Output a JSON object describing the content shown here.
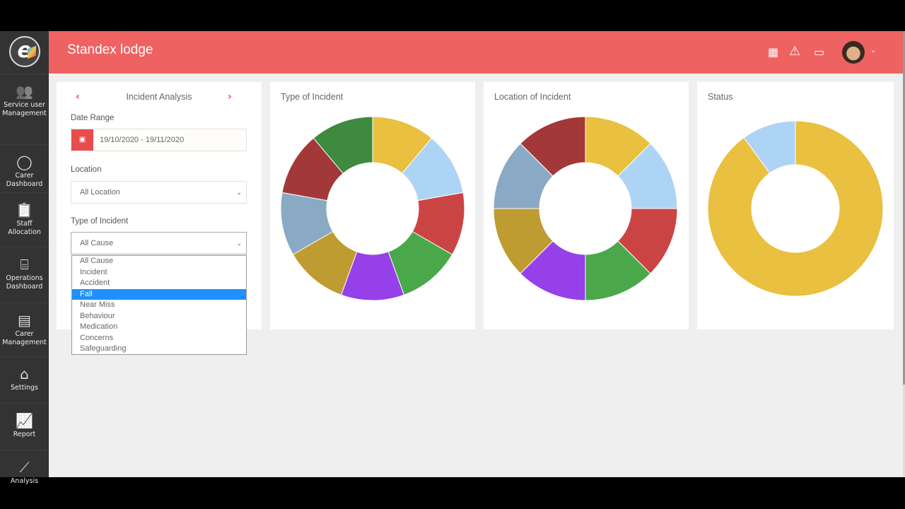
{
  "header": {
    "title": "Standex lodge",
    "icons": [
      "calendar-icon",
      "warning-icon",
      "message-icon"
    ]
  },
  "sidebar": {
    "items": [
      {
        "label1": "Service user",
        "label2": "Management",
        "icon": "users-icon"
      },
      {
        "label1": "Carer",
        "label2": "Dashboard",
        "icon": "user-circle-icon"
      },
      {
        "label1": "Staff",
        "label2": "Allocation",
        "icon": "clipboard-icon"
      },
      {
        "label1": "Operations",
        "label2": "Dashboard",
        "icon": "sitemap-icon"
      },
      {
        "label1": "Carer",
        "label2": "Management",
        "icon": "id-card-icon"
      },
      {
        "label1": "Settings",
        "label2": "",
        "icon": "home-icon"
      },
      {
        "label1": "Report",
        "label2": "",
        "icon": "chart-icon"
      },
      {
        "label1": "Analysis",
        "label2": "",
        "icon": "line-chart-icon"
      }
    ]
  },
  "filter": {
    "title": "Incident Analysis",
    "date_label": "Date Range",
    "date_value": "19/10/2020 - 19/11/2020",
    "location_label": "Location",
    "location_value": "All Location",
    "type_label": "Type of Incident",
    "type_value": "All Cause",
    "options": [
      "All Cause",
      "Incident",
      "Accident",
      "Fall",
      "Near Miss",
      "Behaviour",
      "Medication",
      "Concerns",
      "Safeguarding"
    ],
    "highlighted": "Fall"
  },
  "colors": {
    "header": "#ef6262",
    "highlight": "#1e90ff"
  },
  "chart_data": [
    {
      "type": "pie",
      "title": "Type of Incident",
      "donut": true,
      "values": [
        1,
        1,
        1,
        1,
        1,
        1,
        1,
        1,
        1
      ],
      "colors": [
        "#e9c03f",
        "#aed4f5",
        "#cb4444",
        "#4aa84a",
        "#9540e8",
        "#bf9c32",
        "#8aa9c5",
        "#a33838",
        "#3e8a3e"
      ]
    },
    {
      "type": "pie",
      "title": "Location of Incident",
      "donut": true,
      "values": [
        1,
        1,
        1,
        1,
        1,
        1,
        1,
        1
      ],
      "colors": [
        "#e9c03f",
        "#aed4f5",
        "#cb4444",
        "#4aa84a",
        "#9540e8",
        "#bf9c32",
        "#8aa9c5",
        "#a33838"
      ]
    },
    {
      "type": "pie",
      "title": "Status",
      "donut": true,
      "values": [
        9,
        1
      ],
      "colors": [
        "#e9c03f",
        "#aed4f5"
      ]
    }
  ]
}
